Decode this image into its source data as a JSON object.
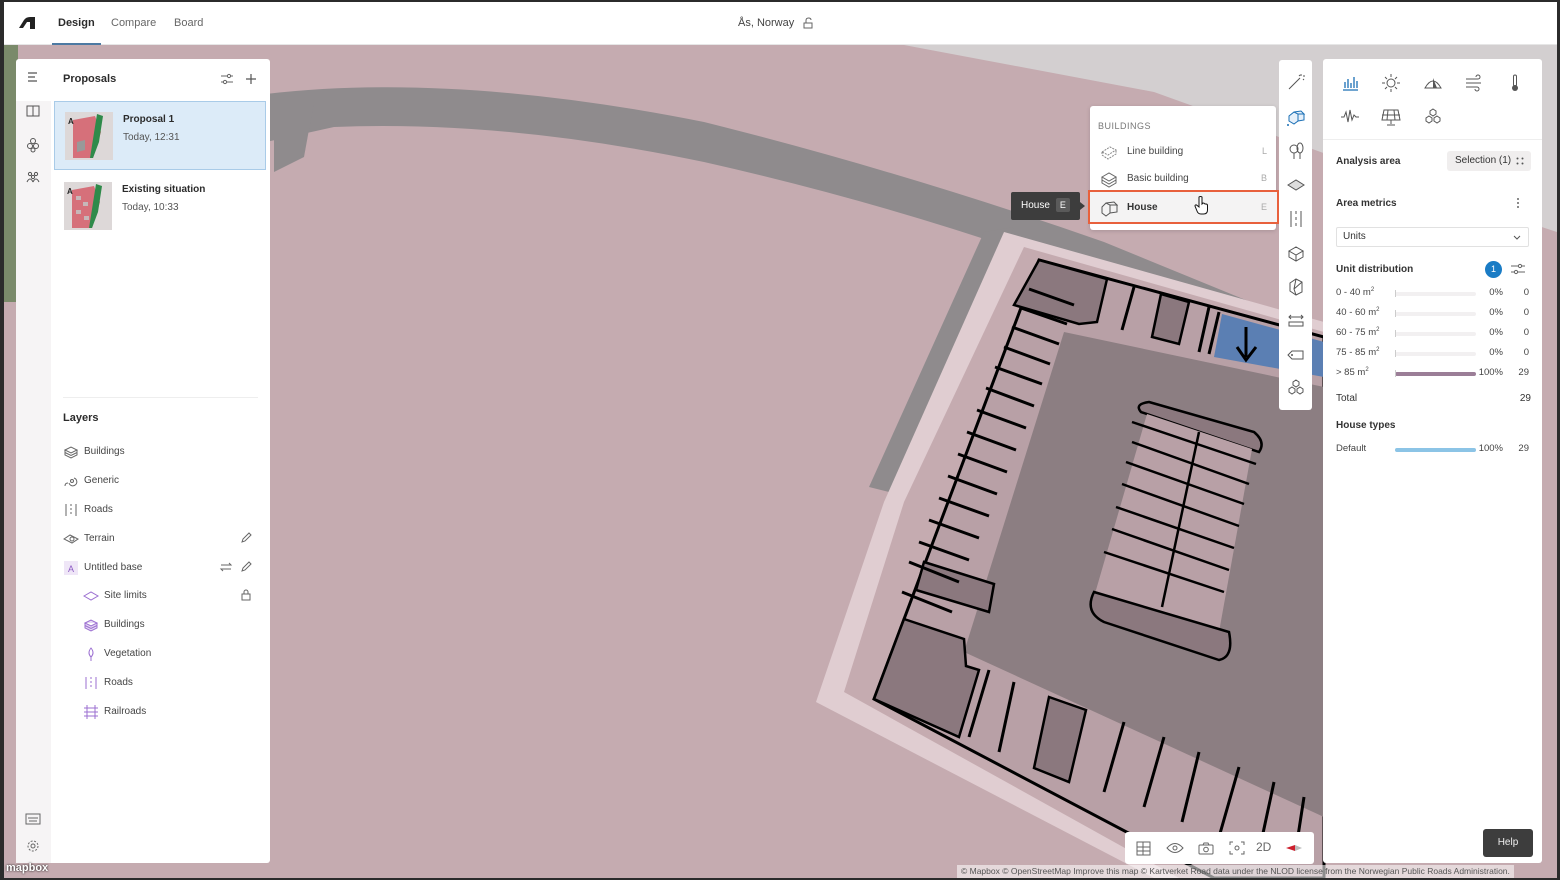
{
  "topbar": {
    "tabs": [
      {
        "label": "Design",
        "active": true
      },
      {
        "label": "Compare",
        "active": false
      },
      {
        "label": "Board",
        "active": false
      }
    ],
    "location": "Ås, Norway"
  },
  "left_panel": {
    "proposals_title": "Proposals",
    "proposals": [
      {
        "name": "Proposal 1",
        "date": "Today, 12:31",
        "selected": true,
        "badge": "A"
      },
      {
        "name": "Existing situation",
        "date": "Today, 10:33",
        "selected": false,
        "badge": "A"
      }
    ],
    "layers_title": "Layers",
    "layers": [
      {
        "label": "Buildings",
        "icon": "buildings-icon"
      },
      {
        "label": "Generic",
        "icon": "generic-icon"
      },
      {
        "label": "Roads",
        "icon": "roads-icon"
      },
      {
        "label": "Terrain",
        "icon": "terrain-icon"
      },
      {
        "label": "Untitled base",
        "icon": "base-a-icon",
        "badge": "A"
      },
      {
        "label": "Site limits",
        "icon": "site-limits-icon",
        "sub": true
      },
      {
        "label": "Buildings",
        "icon": "buildings-icon",
        "sub": true
      },
      {
        "label": "Vegetation",
        "icon": "vegetation-icon",
        "sub": true
      },
      {
        "label": "Roads",
        "icon": "roads-icon",
        "sub": true
      },
      {
        "label": "Railroads",
        "icon": "railroads-icon",
        "sub": true
      }
    ]
  },
  "buildings_menu": {
    "heading": "BUILDINGS",
    "items": [
      {
        "label": "Line building",
        "shortcut": "L"
      },
      {
        "label": "Basic building",
        "shortcut": "B"
      },
      {
        "label": "House",
        "shortcut": "E",
        "highlighted": true
      }
    ],
    "tooltip": {
      "label": "House",
      "shortcut": "E"
    }
  },
  "right_panel": {
    "analysis_area_label": "Analysis area",
    "selection_label": "Selection (1)",
    "area_metrics_label": "Area metrics",
    "metric_select": "Units",
    "unit_distribution_label": "Unit distribution",
    "filter_count": "1",
    "distribution": [
      {
        "range": "0 - 40 m",
        "pct": "0%",
        "fraction": 0,
        "count": "0"
      },
      {
        "range": "40 - 60 m",
        "pct": "0%",
        "fraction": 0,
        "count": "0"
      },
      {
        "range": "60 - 75 m",
        "pct": "0%",
        "fraction": 0,
        "count": "0"
      },
      {
        "range": "75 - 85 m",
        "pct": "0%",
        "fraction": 0,
        "count": "0"
      },
      {
        "range": "> 85 m",
        "pct": "100%",
        "fraction": 1,
        "count": "29"
      }
    ],
    "unit_sup": "2",
    "total_label": "Total",
    "total_value": "29",
    "house_types_label": "House types",
    "house_types": [
      {
        "label": "Default",
        "pct": "100%",
        "fraction": 1,
        "count": "29"
      }
    ],
    "colors": {
      "distribution_bar": "#9b7e97",
      "house_type_bar": "#8cc4e6",
      "badge": "#1a7cc5",
      "highlight": "#e8603c"
    }
  },
  "view_toolbar": {
    "mode_label": "2D"
  },
  "help_label": "Help",
  "attribution": "© Mapbox © OpenStreetMap Improve this map © Kartverket Road data under the NLOD license from the Norwegian Public Roads Administration.",
  "mapbox_label": "mapbox"
}
